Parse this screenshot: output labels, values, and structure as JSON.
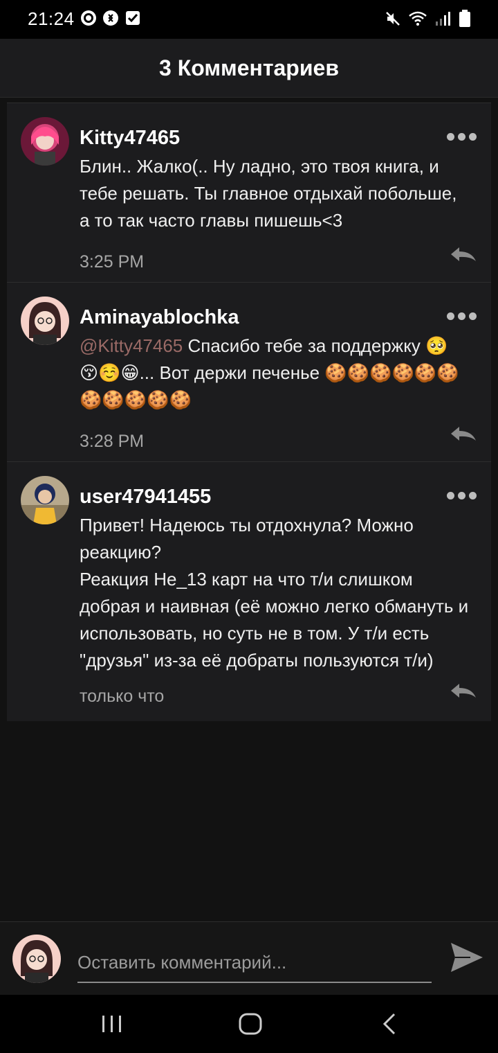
{
  "status_bar": {
    "time": "21:24",
    "left_icons": [
      "instagram-icon",
      "shazam-icon",
      "check-box-icon"
    ],
    "right_icons": [
      "mute-icon",
      "wifi-icon",
      "signal-icon",
      "battery-icon"
    ]
  },
  "header": {
    "title": "3 Комментариев"
  },
  "comments": [
    {
      "author": "Kitty47465",
      "text": "Блин.. Жалко(.. Ну ладно, это твоя книга, и тебе решать. Ты главное отдыхай побольше, а то так часто главы пишешь<3",
      "time": "3:25 PM"
    },
    {
      "author": "Aminayablochka",
      "mention": "@Kitty47465",
      "text_line1": " Спасибо тебе за поддержку 🥺",
      "text_line2": "😚☺️😁... Вот держи печенье 🍪🍪🍪🍪🍪🍪",
      "text_line3": "🍪🍪🍪🍪🍪",
      "time": "3:28 PM"
    },
    {
      "author": "user47941455",
      "text_p1": "Привет! Надеюсь ты отдохнула? Можно реакцию?",
      "text_p2": "Реакция Не_13 карт на что т/и слишком добрая и наивная (её можно легко обмануть и использовать, но суть не в том. У т/и есть \"друзья\" из-за её добраты пользуются т/и)",
      "time": "только что"
    }
  ],
  "input": {
    "placeholder": "Оставить комментарий..."
  },
  "colors": {
    "background": "#121212",
    "card": "#1c1c1e",
    "mention": "#9a6a66",
    "muted": "#a6a6a6"
  }
}
